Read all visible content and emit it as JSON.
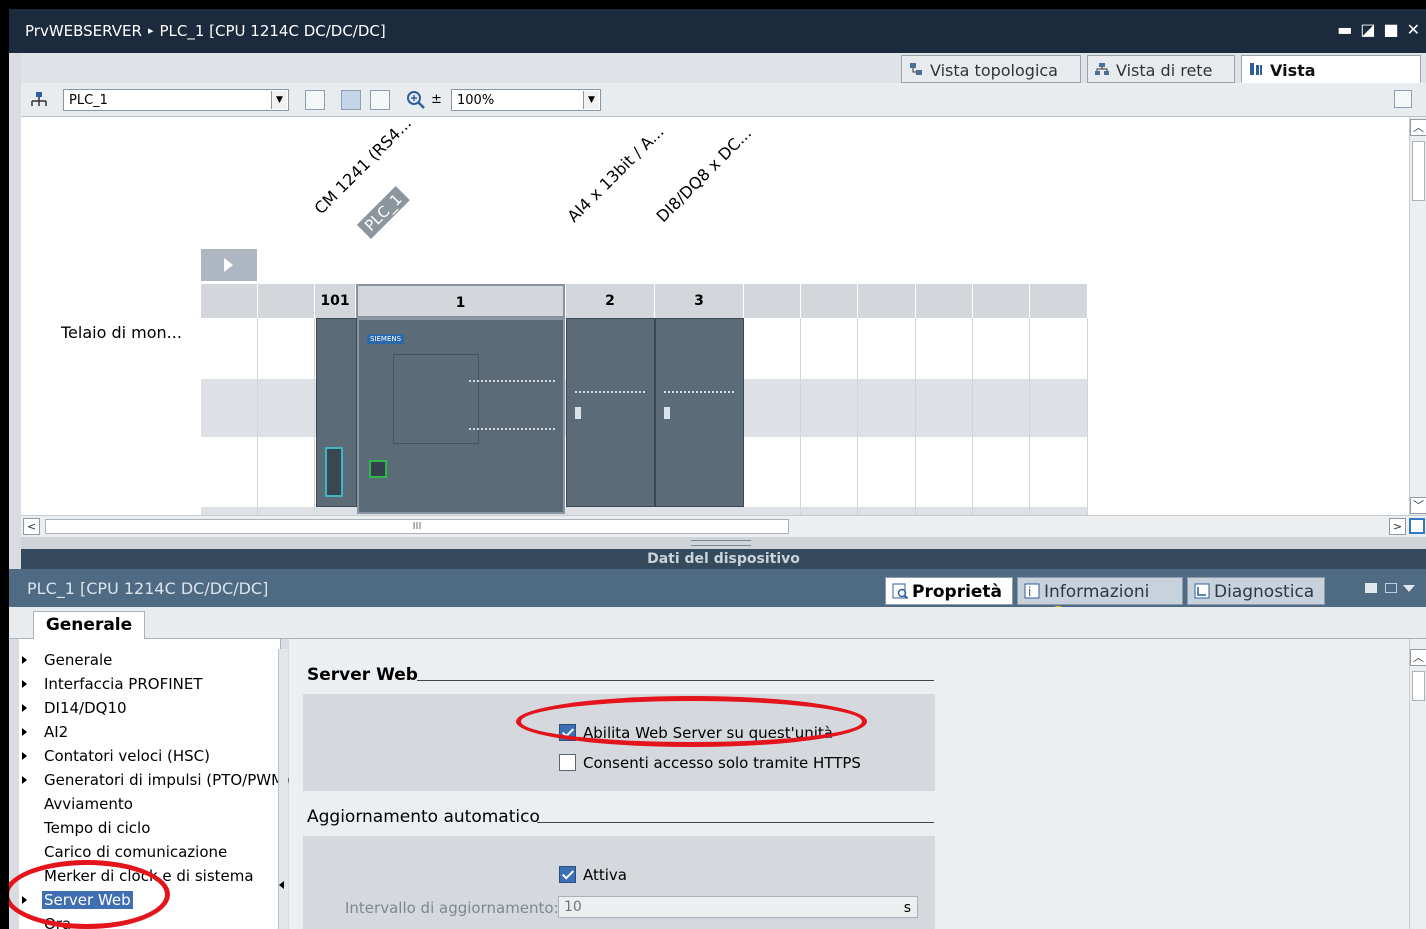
{
  "window": {
    "title_project": "PrvWEBSERVER",
    "title_separator": "▸",
    "title_device": "PLC_1 [CPU 1214C DC/DC/DC]",
    "controls": [
      "▬",
      "◪",
      "■",
      "✕"
    ]
  },
  "view_tabs": [
    {
      "label": "Vista topologica",
      "icon": "topology-view-icon",
      "active": false
    },
    {
      "label": "Vista di rete",
      "icon": "network-view-icon",
      "active": false
    },
    {
      "label": "Vista dispositivi",
      "icon": "device-view-icon",
      "active": true
    }
  ],
  "toolbar": {
    "device_select": "PLC_1",
    "zoom_value": "100%",
    "zoom_arrow": "±"
  },
  "device_view": {
    "module_labels": [
      "CM 1241 (RS4...",
      "AI4 x 13bit / A...",
      "DI8/DQ8 x DC..."
    ],
    "plc_tag": "PLC_1",
    "rack_label": "Telaio di mon...",
    "slots": [
      "101",
      "1",
      "2",
      "3"
    ],
    "brand": "SIEMENS",
    "scroll_mark": "III"
  },
  "device_data_bar": "Dati del dispositivo",
  "inspector": {
    "title": "PLC_1 [CPU 1214C DC/DC/DC]",
    "tabs": [
      {
        "label": "Proprietà",
        "icon": "properties-icon",
        "active": true
      },
      {
        "label": "Informazioni",
        "icon": "info-icon",
        "active": false
      },
      {
        "label": "Diagnostica",
        "icon": "diagnostics-icon",
        "active": false
      }
    ],
    "info_badge": "i",
    "general_tab": "Generale"
  },
  "nav_tree": [
    {
      "label": "Generale",
      "expandable": true
    },
    {
      "label": "Interfaccia PROFINET",
      "expandable": true
    },
    {
      "label": "DI14/DQ10",
      "expandable": true
    },
    {
      "label": "AI2",
      "expandable": true
    },
    {
      "label": "Contatori veloci (HSC)",
      "expandable": true
    },
    {
      "label": "Generatori di impulsi (PTO/PWM)",
      "expandable": true
    },
    {
      "label": "Avviamento",
      "expandable": false
    },
    {
      "label": "Tempo di ciclo",
      "expandable": false
    },
    {
      "label": "Carico di comunicazione",
      "expandable": false
    },
    {
      "label": "Merker di clock e di sistema",
      "expandable": false
    },
    {
      "label": "Server Web",
      "expandable": true,
      "selected": true
    },
    {
      "label": "Ora",
      "expandable": false
    }
  ],
  "content": {
    "web_server_title": "Server Web",
    "enable_web_server": {
      "label": "Abilita Web Server su quest'unità",
      "checked": true
    },
    "https_only": {
      "label": "Consenti accesso solo tramite HTTPS",
      "checked": false
    },
    "auto_update_title": "Aggiornamento automatico",
    "auto_update_active": {
      "label": "Attiva",
      "checked": true
    },
    "update_interval_label": "Intervallo di aggiornamento:",
    "update_interval_value": "10",
    "update_interval_unit": "s"
  },
  "colors": {
    "highlight_ring": "#e3141b",
    "title_bar": "#1b2a3c",
    "selection": "#3f6fb1"
  }
}
